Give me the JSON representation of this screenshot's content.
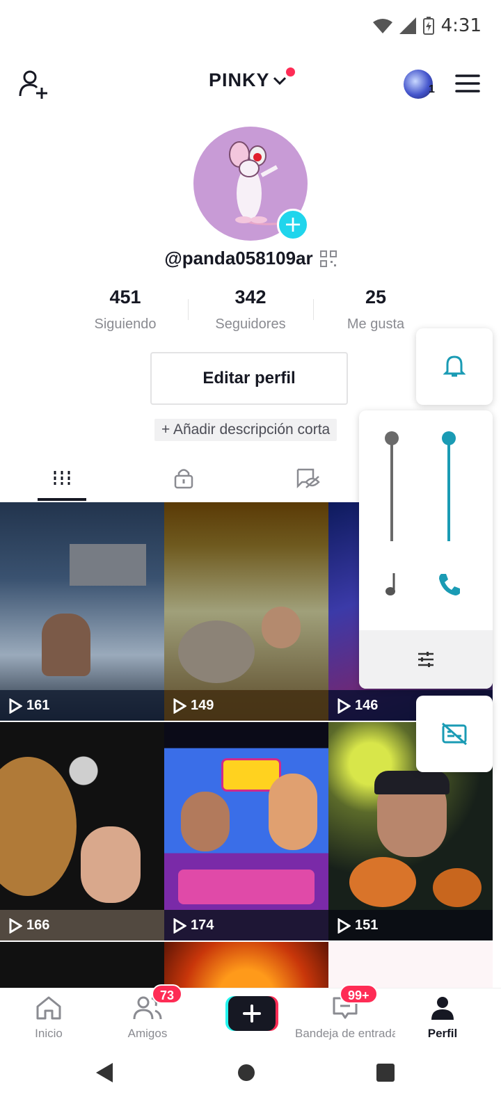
{
  "status_bar": {
    "time": "4:31"
  },
  "header": {
    "account_name": "PINKY",
    "switcher_count": "1"
  },
  "profile": {
    "username": "@panda058109ar",
    "stats": [
      {
        "value": "451",
        "label": "Siguiendo"
      },
      {
        "value": "342",
        "label": "Seguidores"
      },
      {
        "value": "25",
        "label": "Me gusta"
      }
    ],
    "edit_button": "Editar perfil",
    "add_description": "+ Añadir descripción corta"
  },
  "tabs": [
    "videos-grid-icon",
    "lock-icon",
    "hidden-eye-icon"
  ],
  "videos": [
    {
      "views": "161",
      "theme": "walkers-snow"
    },
    {
      "views": "149",
      "theme": "forest-bear"
    },
    {
      "views": "146",
      "theme": "fantasy-blue"
    },
    {
      "views": "166",
      "theme": "lion-moon"
    },
    {
      "views": "174",
      "theme": "wow-music"
    },
    {
      "views": "151",
      "theme": "halloween-pumpkins"
    },
    {
      "views": "",
      "theme": "partial-1"
    },
    {
      "views": "",
      "theme": "partial-2"
    }
  ],
  "bottom_nav": {
    "home": "Inicio",
    "friends": "Amigos",
    "friends_badge": "73",
    "inbox": "Bandeja de entrada",
    "inbox_badge": "99+",
    "profile": "Perfil"
  },
  "colors": {
    "accent": "#20d5ec",
    "badge": "#fe2c55",
    "volume_teal": "#1a9bb4"
  }
}
